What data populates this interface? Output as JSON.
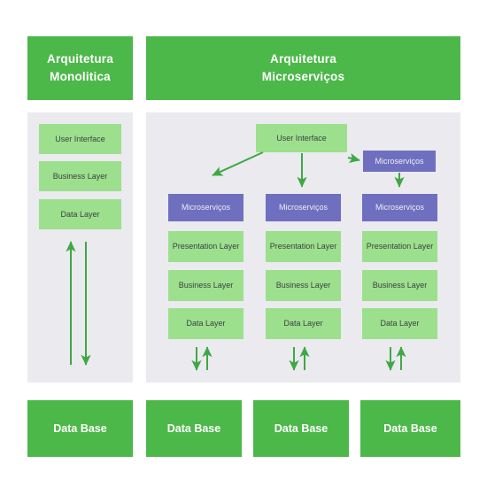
{
  "diagram": {
    "headers": [
      {
        "id": "monolithic",
        "label": "Arquitetura\nMonolitica",
        "line1": "Arquitetura",
        "line2": "Monolitica"
      },
      {
        "id": "microservices",
        "label": "Arquitetura\nMicroserviços",
        "line1": "Arquitetura",
        "line2": "Microserviços"
      }
    ],
    "monolith": {
      "layers": [
        {
          "label": "User Interface"
        },
        {
          "label": "Business Layer"
        },
        {
          "label": "Data Layer"
        }
      ],
      "arrows": [
        {
          "name": "arrow-up",
          "direction": "up"
        },
        {
          "name": "arrow-down",
          "direction": "down"
        }
      ]
    },
    "microservices": {
      "entry": {
        "label": "User Interface"
      },
      "gateway": {
        "label": "Microserviços"
      },
      "columns": [
        {
          "service": "Microserviços",
          "layers": [
            "Presentation Layer",
            "Business Layer",
            "Data Layer"
          ],
          "arrows": [
            "down",
            "up"
          ]
        },
        {
          "service": "Microserviços",
          "layers": [
            "Presentation Layer",
            "Business Layer",
            "Data Layer"
          ],
          "arrows": [
            "down",
            "up"
          ]
        },
        {
          "service": "Microserviços",
          "layers": [
            "Presentation Layer",
            "Business Layer",
            "Data Layer"
          ],
          "arrows": [
            "down",
            "up"
          ]
        }
      ]
    },
    "databases": [
      {
        "label": "Data Base"
      },
      {
        "label": "Data Base"
      },
      {
        "label": "Data Base"
      },
      {
        "label": "Data Base"
      }
    ],
    "colors": {
      "header_green": "#4CB849",
      "box_light_green": "#9CE08D",
      "service_purple": "#6F6FC0",
      "panel_grey": "#EAEAEF",
      "arrow_green": "#3FA845",
      "page_background": "#FFFFFF",
      "header_text": "#FFFFFF",
      "box_text": "#3C4043"
    }
  }
}
